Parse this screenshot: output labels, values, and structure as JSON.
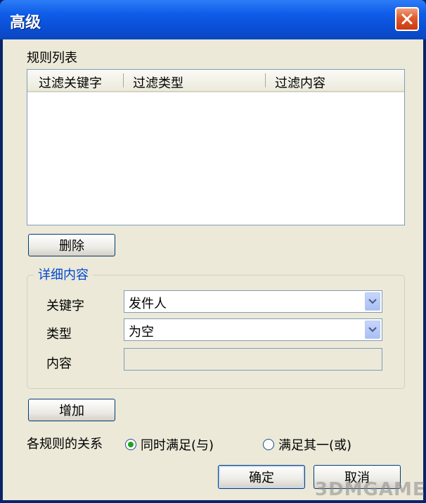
{
  "window": {
    "title": "高级"
  },
  "rules": {
    "section_label": "规则列表",
    "columns": [
      "过滤关键字",
      "过滤类型",
      "过滤内容"
    ],
    "delete_label": "删除"
  },
  "details": {
    "group_title": "详细内容",
    "keyword_label": "关键字",
    "keyword_value": "发件人",
    "type_label": "类型",
    "type_value": "为空",
    "content_label": "内容",
    "content_value": ""
  },
  "add_label": "增加",
  "relation": {
    "label": "各规则的关系",
    "options": [
      {
        "label": "同时满足(与)",
        "selected": true
      },
      {
        "label": "满足其一(或)",
        "selected": false
      }
    ]
  },
  "ok_label": "确定",
  "cancel_label": "取消",
  "watermark": "3DMGAME",
  "colors": {
    "title_bar": "#0a4fd6",
    "dialog_bg": "#ece9d8",
    "group_title": "#0046d5",
    "close": "#e05a2c"
  }
}
